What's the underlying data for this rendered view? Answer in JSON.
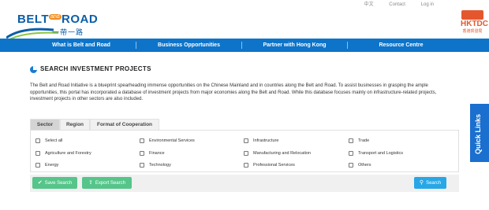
{
  "brand": {
    "logo_left": "BELT",
    "logo_and": "and",
    "logo_right": "ROAD",
    "logo_sub": "一帶一路",
    "partner_logo": "HKTDC",
    "partner_logo_cn": "香港貿發局"
  },
  "top_links": [
    "中文",
    "Contact",
    "Log in"
  ],
  "nav": {
    "items": [
      {
        "label": "What is Belt and Road"
      },
      {
        "label": "Business Opportunities"
      },
      {
        "label": "Partner with Hong Kong"
      },
      {
        "label": "Resource Centre"
      }
    ]
  },
  "page": {
    "title": "SEARCH INVESTMENT PROJECTS",
    "intro": "The Belt and Road Initiative is a blueprint spearheading immense opportunities on the Chinese Mainland and in countries along the Belt and Road. To assist businesses in grasping the ample opportunities, this portal has incorporated a database of investment projects from major economies along the Belt and Road.  While this database focuses mainly on infrastructure-related projects, investment projects in other sectors are also included."
  },
  "tabs": [
    {
      "label": "Sector",
      "active": true
    },
    {
      "label": "Region",
      "active": false
    },
    {
      "label": "Format of Cooperation",
      "active": false
    }
  ],
  "sector_options": [
    {
      "label": "Select all",
      "checked": false
    },
    {
      "label": "Environmental Services",
      "checked": false
    },
    {
      "label": "Infrastructure",
      "checked": false
    },
    {
      "label": "Trade",
      "checked": false
    },
    {
      "label": "Agriculture and Forestry",
      "checked": false
    },
    {
      "label": "Finance",
      "checked": false
    },
    {
      "label": "Manufacturing and Relocation",
      "checked": false
    },
    {
      "label": "Transport and Logistics",
      "checked": false
    },
    {
      "label": "Energy",
      "checked": false
    },
    {
      "label": "Technology",
      "checked": false
    },
    {
      "label": "Professional Services",
      "checked": false
    },
    {
      "label": "Others",
      "checked": false
    }
  ],
  "actions": {
    "save_label": "Save Search",
    "export_label": "Export Search",
    "search_label": "Search"
  },
  "quick_links": "Quick Links",
  "colors": {
    "nav_bg": "#0d74c9",
    "brand_blue": "#0b5ea8",
    "accent_orange": "#f28c1e",
    "hktdc_red": "#e4572e",
    "button_green": "#55c58a",
    "button_blue": "#27a7e6"
  }
}
